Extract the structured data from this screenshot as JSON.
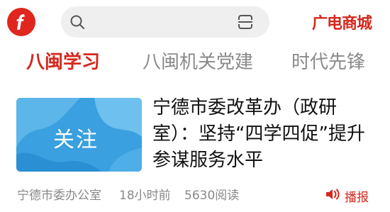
{
  "header": {
    "search_placeholder": "",
    "brand_text": "广电商城",
    "icons": [
      "app-logo-icon",
      "search-icon",
      "scan-icon"
    ],
    "accent_color": "#d4281d"
  },
  "tabs": [
    {
      "label": "八闽学习",
      "active": true
    },
    {
      "label": "八闽机关党建",
      "active": false
    },
    {
      "label": "时代先锋",
      "active": false
    }
  ],
  "article": {
    "thumbnail_text": "关注",
    "thumbnail_subtext": "",
    "title": "宁德市委改革办（政研室）：坚持“四学四促”提升参谋服务水平",
    "source": "宁德市委办公室",
    "time": "18小时前",
    "reads": "5630阅读",
    "broadcast_label": "播报"
  }
}
